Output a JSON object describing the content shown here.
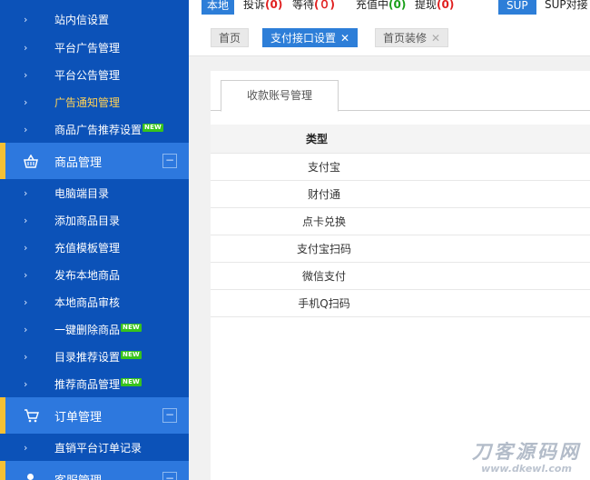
{
  "sidebar": {
    "items_top": [
      {
        "label": "站内信设置"
      },
      {
        "label": "平台广告管理"
      },
      {
        "label": "平台公告管理"
      },
      {
        "label": "广告通知管理"
      },
      {
        "label": "商品广告推荐设置",
        "badge": "NEW"
      }
    ],
    "group_goods": {
      "label": "商品管理",
      "collapse": "−"
    },
    "items_goods": [
      {
        "label": "电脑端目录"
      },
      {
        "label": "添加商品目录"
      },
      {
        "label": "充值模板管理"
      },
      {
        "label": "发布本地商品"
      },
      {
        "label": "本地商品审核"
      },
      {
        "label": "一键删除商品",
        "badge": "NEW"
      },
      {
        "label": "目录推荐设置",
        "badge": "NEW"
      },
      {
        "label": "推荐商品管理",
        "badge": "NEW"
      }
    ],
    "group_orders": {
      "label": "订单管理",
      "collapse": "−"
    },
    "items_orders": [
      {
        "label": "直销平台订单记录"
      }
    ],
    "group_service": {
      "label": "客服管理",
      "collapse": "−"
    }
  },
  "topbar": {
    "local_label": "本地",
    "complaint_label": "投诉",
    "complaint_count": "(0)",
    "waiting_label": "等待",
    "waiting_count": "(０)",
    "recharging_label": "充值中",
    "recharging_count": "(0)",
    "withdraw_label": "提现",
    "withdraw_count": "(0)",
    "sup_label": "SUP",
    "sup_connect_label": "SUP对接"
  },
  "tabs": {
    "home": "首页",
    "payment": "支付接口设置",
    "decor": "首页装修",
    "close": "✕"
  },
  "panel": {
    "tab_label": "收款账号管理",
    "table": {
      "header": "类型",
      "rows": [
        "支付宝",
        "财付通",
        "点卡兑换",
        "支付宝扫码",
        "微信支付",
        "手机Q扫码"
      ]
    }
  },
  "watermark": {
    "text": "刀客源码网",
    "url": "www.dkewl.com"
  },
  "colors": {
    "sidebar_bg": "#0c52b8",
    "group_bg": "#2d78de",
    "accent_yellow": "#f5c034",
    "active_label": "#ffd257",
    "primary_blue": "#2d7ed8",
    "badge_green": "#38c31c"
  }
}
